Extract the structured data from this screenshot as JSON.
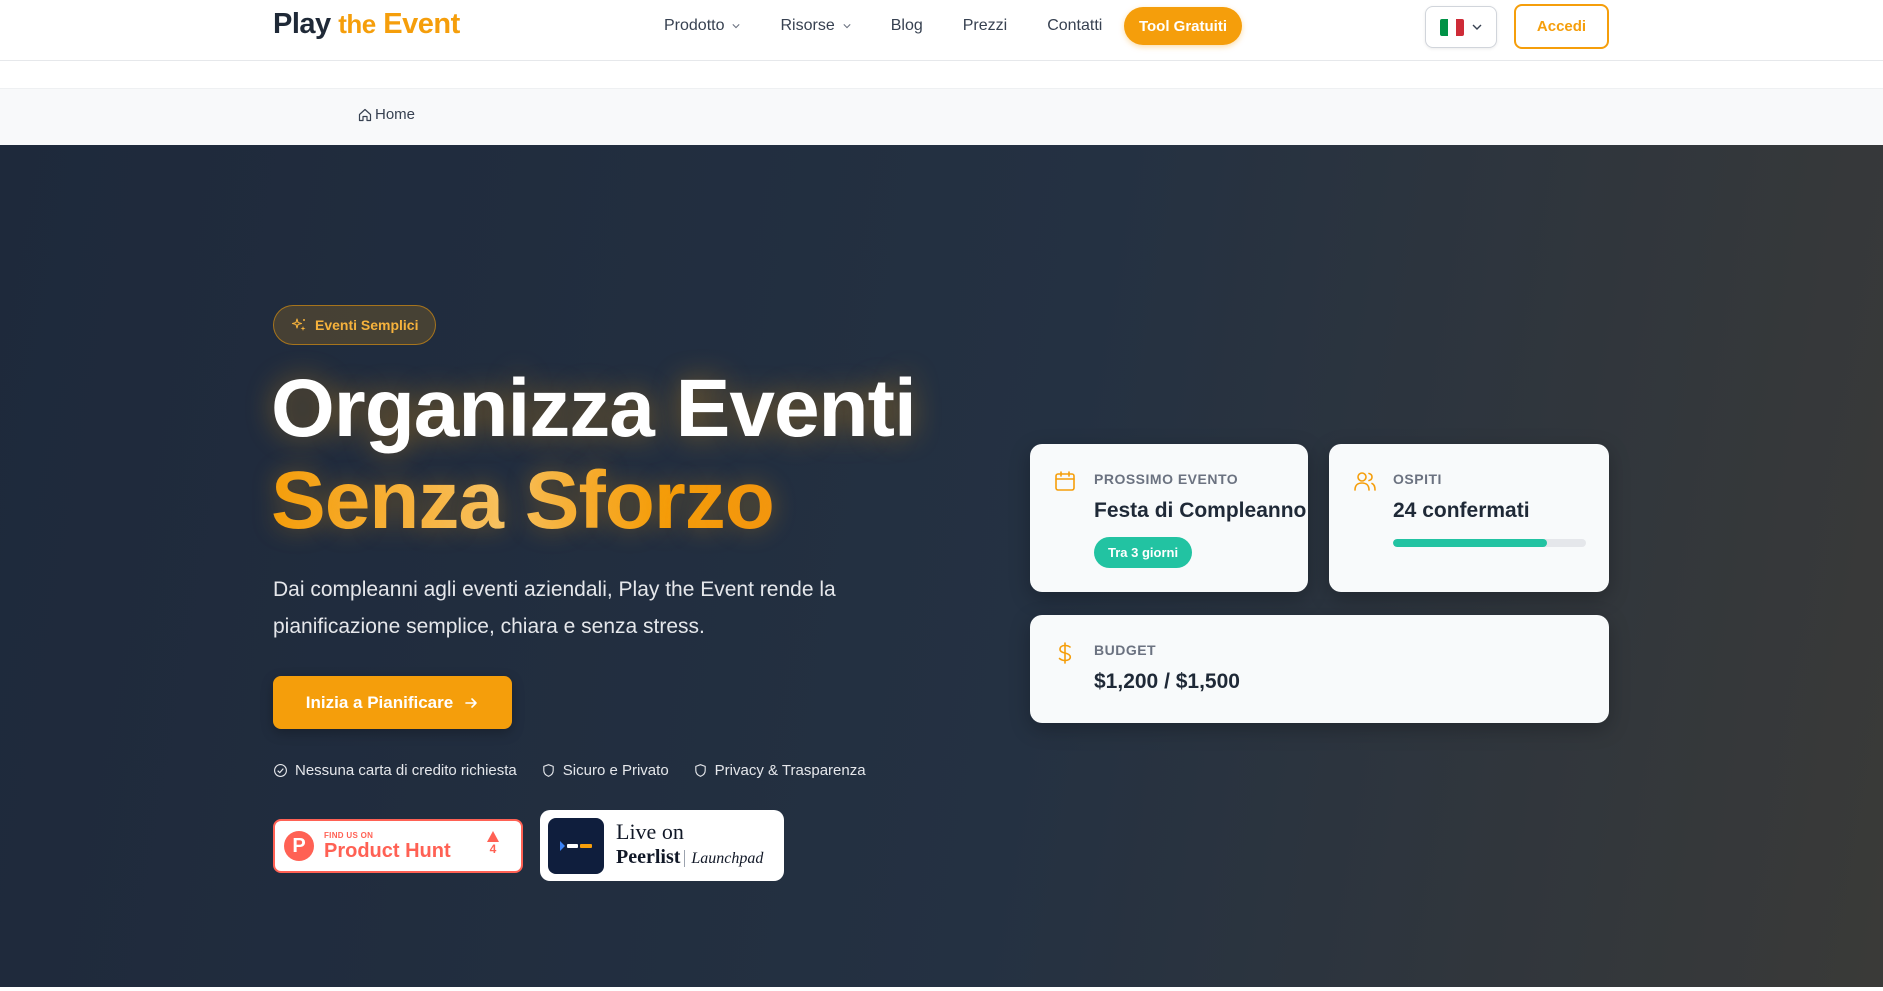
{
  "header": {
    "logo": {
      "play": "Play",
      "the": "the",
      "event": "Event"
    },
    "nav": [
      {
        "label": "Prodotto",
        "dropdown": true
      },
      {
        "label": "Risorse",
        "dropdown": true
      },
      {
        "label": "Blog",
        "dropdown": false
      },
      {
        "label": "Prezzi",
        "dropdown": false
      },
      {
        "label": "Contatti",
        "dropdown": false
      }
    ],
    "tools_button": "Tool Gratuiti",
    "language": "it",
    "login_button": "Accedi"
  },
  "breadcrumb": {
    "home": "Home"
  },
  "hero": {
    "badge": "Eventi Semplici",
    "title_line1": "Organizza Eventi",
    "title_line2": "Senza Sforzo",
    "subtitle": "Dai compleanni agli eventi aziendali, Play the Event rende la pianificazione semplice, chiara e senza stress.",
    "cta": "Inizia a Pianificare",
    "trust": [
      {
        "icon": "check-circle-icon",
        "label": "Nessuna carta di credito richiesta"
      },
      {
        "icon": "shield-icon",
        "label": "Sicuro e Privato"
      },
      {
        "icon": "shield-icon",
        "label": "Privacy & Trasparenza"
      }
    ],
    "product_hunt": {
      "find": "FIND US ON",
      "name": "Product Hunt",
      "votes": "4"
    },
    "peerlist": {
      "live": "Live on",
      "name": "Peerlist",
      "launchpad": "Launchpad"
    }
  },
  "cards": {
    "next_event": {
      "label": "Prossimo Evento",
      "value": "Festa di Compleanno",
      "badge": "Tra 3 giorni"
    },
    "guests": {
      "label": "Ospiti",
      "value": "24 confermati",
      "progress_pct": 80
    },
    "budget": {
      "label": "Budget",
      "value": "$1,200 / $1,500"
    }
  },
  "colors": {
    "accent": "#f59e0b",
    "teal": "#22c3a2",
    "hero_bg": "#1e293b"
  }
}
